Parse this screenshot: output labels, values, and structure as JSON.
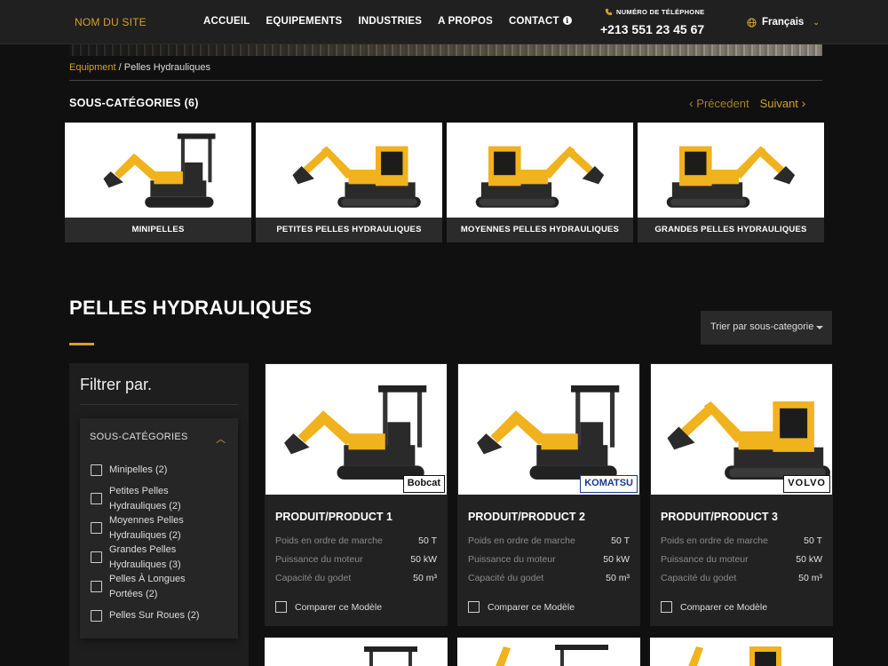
{
  "header": {
    "site_name": "NOM DU SITE",
    "nav": [
      "ACCUEIL",
      "EQUIPEMENTS",
      "INDUSTRIES",
      "A PROPOS",
      "CONTACT"
    ],
    "phone_label": "NUMÉRO DE TÉLÉPHONE",
    "phone_number": "+213 551 23 45 67",
    "language": "Français"
  },
  "breadcrumb": {
    "parent": "Equipment",
    "separator": " / ",
    "current": "Pelles Hydrauliques"
  },
  "subcategories": {
    "title": "SOUS-CATÉGORIES (6)",
    "prev": "Précedent",
    "next": "Suivant",
    "items": [
      "MINIPELLES",
      "PETITES PELLES HYDRAULIQUES",
      "MOYENNES PELLES HYDRAULIQUES",
      "GRANDES PELLES HYDRAULIQUES"
    ]
  },
  "section": {
    "title": "PELLES HYDRAULIQUES",
    "sort_label": "Trier par sous-categorie"
  },
  "filter": {
    "title": "Filtrer par.",
    "group": "SOUS-CATÉGORIES",
    "options": [
      "Minipelles (2)",
      "Petites Pelles Hydrauliques (2)",
      "Moyennes Pelles Hydrauliques (2)",
      "Grandes Pelles Hydrauliques (3)",
      "Pelles À Longues Portées (2)",
      "Pelles Sur Roues (2)"
    ]
  },
  "products": [
    {
      "name": "PRODUIT/PRODUCT 1",
      "brand": "Bobcat",
      "specs": [
        [
          "Poids en ordre de marche",
          "50 T"
        ],
        [
          "Puissance du moteur",
          "50 kW"
        ],
        [
          "Capacité du godet",
          "50 m³"
        ]
      ],
      "compare": "Comparer ce Modèle"
    },
    {
      "name": "PRODUIT/PRODUCT 2",
      "brand": "KOMATSU",
      "specs": [
        [
          "Poids en ordre de marche",
          "50 T"
        ],
        [
          "Puissance du moteur",
          "50 kW"
        ],
        [
          "Capacité du godet",
          "50 m³"
        ]
      ],
      "compare": "Comparer ce Modèle"
    },
    {
      "name": "PRODUIT/PRODUCT 3",
      "brand": "VOLVO",
      "specs": [
        [
          "Poids en ordre de marche",
          "50 T"
        ],
        [
          "Puissance du moteur",
          "50 kW"
        ],
        [
          "Capacité du godet",
          "50 m³"
        ]
      ],
      "compare": "Comparer ce Modèle"
    }
  ],
  "colors": {
    "accent": "#d3a12a",
    "background": "#101010",
    "card": "#222222",
    "excavator": "#f0b21d"
  }
}
